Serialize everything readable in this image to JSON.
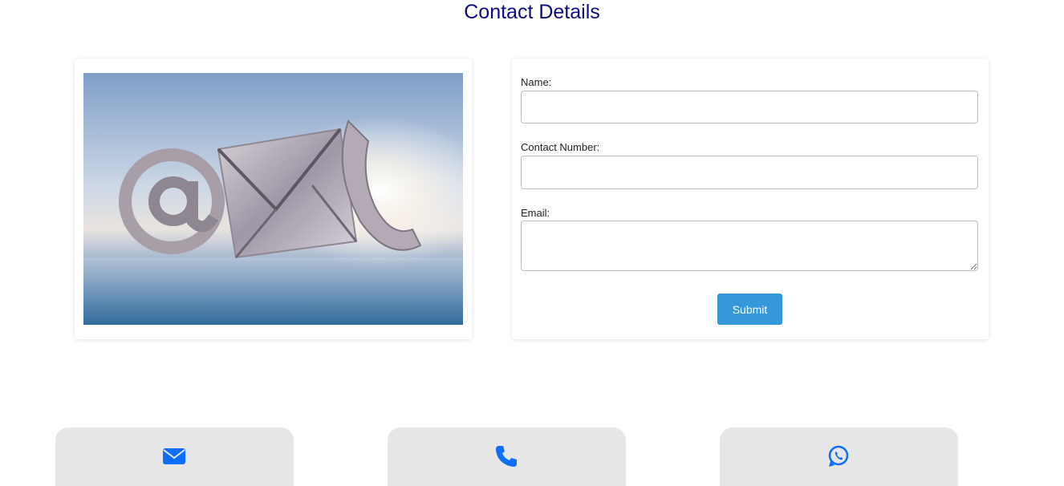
{
  "page": {
    "title": "Contact Details"
  },
  "form": {
    "name_label": "Name:",
    "name_value": "",
    "contact_label": "Contact Number:",
    "contact_value": "",
    "email_label": "Email:",
    "email_value": "",
    "submit_label": "Submit"
  },
  "image": {
    "description_icons": [
      "at-sign-icon",
      "envelope-icon",
      "phone-icon"
    ]
  },
  "contact_tiles": [
    {
      "icon": "envelope-icon"
    },
    {
      "icon": "phone-icon"
    },
    {
      "icon": "whatsapp-icon"
    }
  ],
  "colors": {
    "title": "#0b0b85",
    "submit_bg": "#3498db",
    "icon_blue": "#0d6efd",
    "tile_bg": "#e6e6e6"
  }
}
